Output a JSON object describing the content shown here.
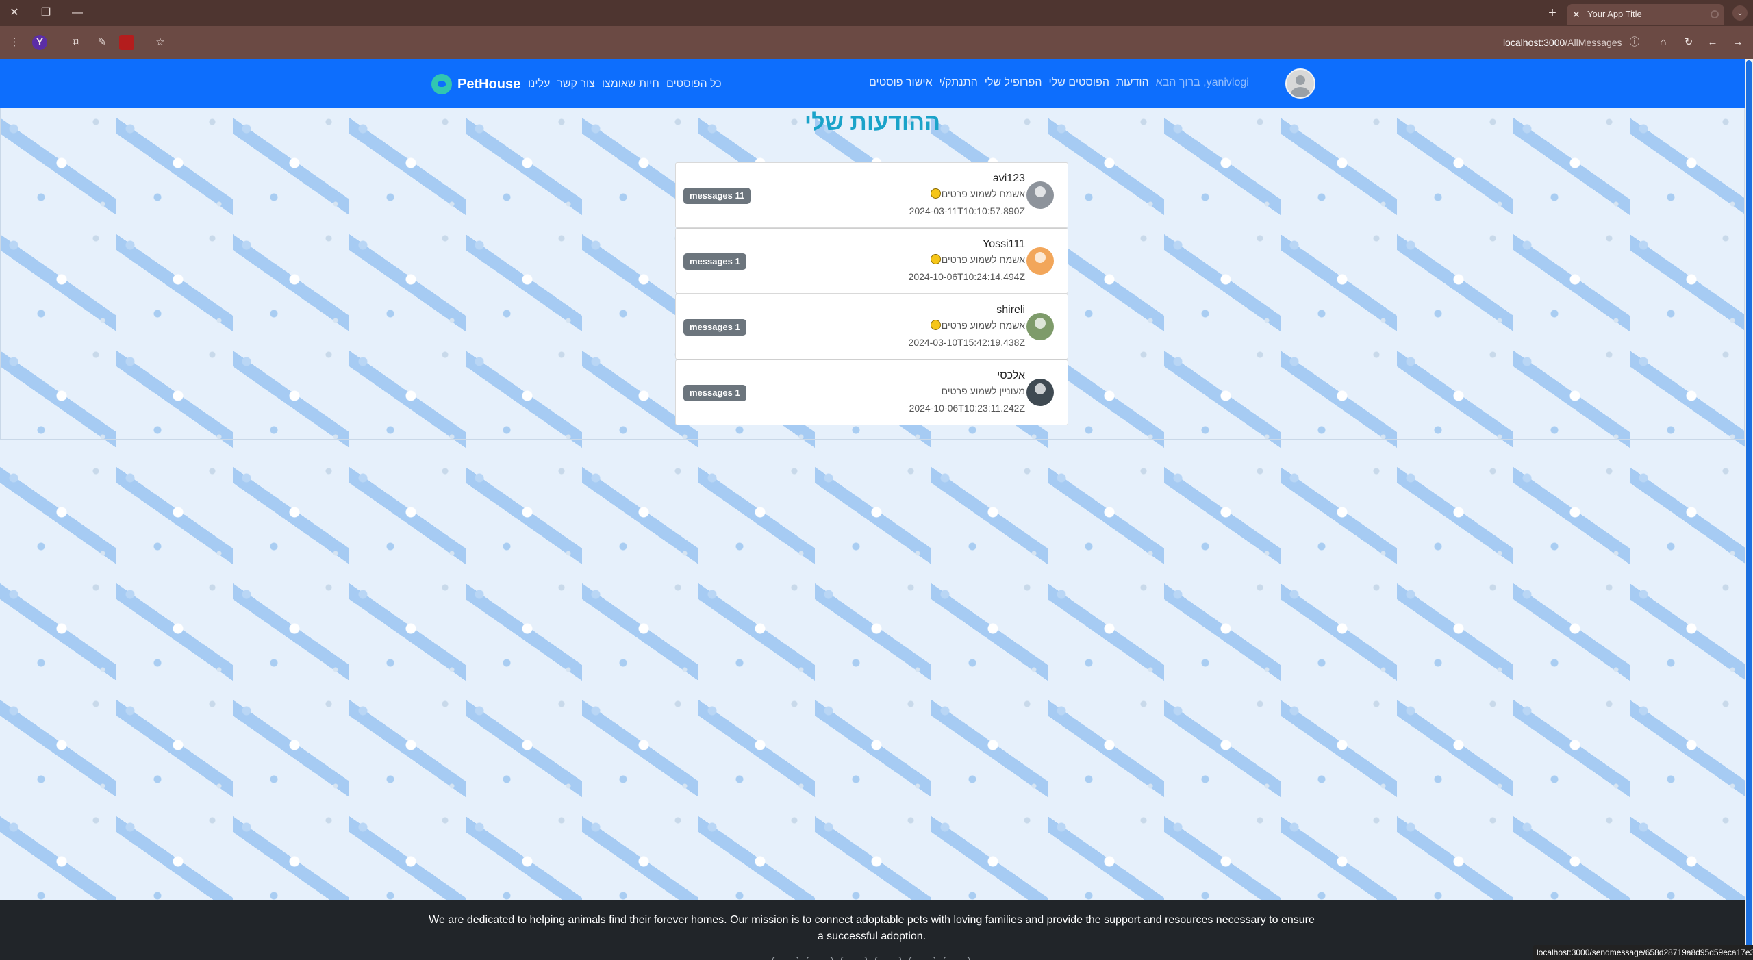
{
  "browser": {
    "tab_title": "Your App Title",
    "url_host": "localhost:3000",
    "url_path": "/AllMessages",
    "status_link": "localhost:3000/sendmessage/658d28719a8d95d59eca17e3"
  },
  "navbar": {
    "brand": "PetHouse",
    "left_links": [
      "כל הפוסטים",
      "חיות שאומצו",
      "צור קשר",
      "עלינו"
    ],
    "right_links": [
      "yanivlogi, ברוך הבא",
      "הודעות",
      "הפוסטים שלי",
      "הפרופיל שלי",
      "התנתק/י",
      "אישור פוסטים"
    ]
  },
  "page": {
    "title": "ההודעות שלי"
  },
  "messages": [
    {
      "user": "avi123",
      "text": "אשמח לשמוע פרטים",
      "date": "2024-03-11T10:10:57.890Z",
      "badge": "messages 11",
      "avatar_color": "#8d939b",
      "emoji": true
    },
    {
      "user": "Yossi111",
      "text": "אשמח לשמוע פרטים",
      "date": "2024-10-06T10:24:14.494Z",
      "badge": "messages 1",
      "avatar_color": "#f2a65a",
      "emoji": true
    },
    {
      "user": "shireli",
      "text": "אשמח לשמוע פרטים",
      "date": "2024-03-10T15:42:19.438Z",
      "badge": "messages 1",
      "avatar_color": "#7e9b6a",
      "emoji": true
    },
    {
      "user": "אלכסי",
      "text": "מעוניין לשמוע פרטים",
      "date": "2024-10-06T10:23:11.242Z",
      "badge": "messages 1",
      "avatar_color": "#3f4a52",
      "emoji": false
    }
  ],
  "footer": {
    "text": "We are dedicated to helping animals find their forever homes. Our mission is to connect adoptable pets with loving families and provide the support and resources necessary to ensure a successful adoption."
  },
  "colors": {
    "navbar": "#0d6efd",
    "title": "#1aa3c9",
    "badge": "#6c757d",
    "footer": "#212529"
  }
}
